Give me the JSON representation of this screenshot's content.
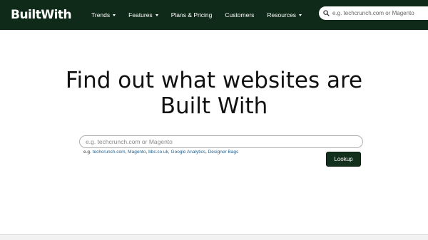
{
  "header": {
    "logo_text": "BuiltWith",
    "nav": [
      {
        "label": "Trends",
        "dropdown": true
      },
      {
        "label": "Features",
        "dropdown": true
      },
      {
        "label": "Plans & Pricing",
        "dropdown": false
      },
      {
        "label": "Customers",
        "dropdown": false
      },
      {
        "label": "Resources",
        "dropdown": true
      }
    ],
    "search": {
      "placeholder": "e.g. techcrunch.com or Magento",
      "icon": "search-icon"
    }
  },
  "hero": {
    "title_line1": "Find out what websites are",
    "title_line2": "Built With"
  },
  "main_search": {
    "placeholder": "e.g. techcrunch.com or Magento",
    "examples_prefix": "e.g.",
    "examples": [
      "techcrunch.com",
      "Magento",
      "bbc.co.uk",
      "Google Analytics",
      "Designer Bags"
    ],
    "lookup_label": "Lookup"
  },
  "colors": {
    "navbar_bg": "#0f2a18",
    "button_bg": "#12301c",
    "link": "#1f5d8c"
  }
}
